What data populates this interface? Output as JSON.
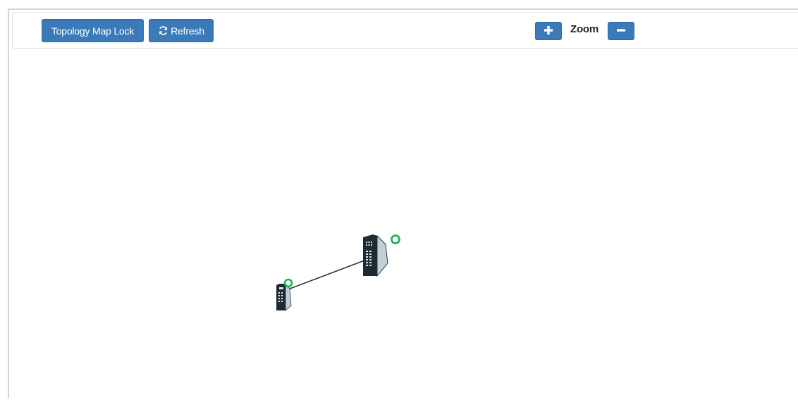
{
  "toolbar": {
    "lock_label": "Topology Map Lock",
    "refresh_label": "Refresh",
    "refresh_icon": "refresh-icon",
    "zoom_label": "Zoom",
    "zoom_in_icon": "plus-icon",
    "zoom_out_icon": "minus-icon"
  },
  "colors": {
    "button": "#3a7ab8",
    "device_dark": "#1f2b33",
    "device_side": "#c3cfd6",
    "status_ok": "#1fb15a",
    "link": "#333333"
  },
  "topology": {
    "devices": [
      {
        "id": "switch-small",
        "type": "industrial-switch",
        "status": "online"
      },
      {
        "id": "switch-large",
        "type": "industrial-switch",
        "status": "online"
      }
    ],
    "links": [
      {
        "from": "switch-small",
        "to": "switch-large"
      }
    ]
  }
}
